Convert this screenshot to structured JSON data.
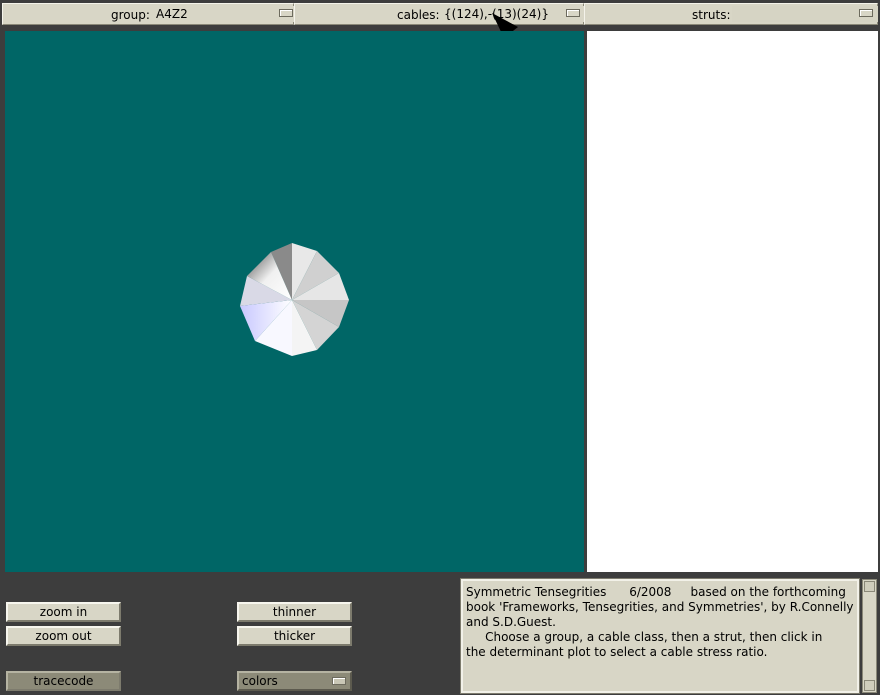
{
  "toolbar": {
    "group_label": "group:",
    "group_value": "A4Z2",
    "cables_label": "cables:",
    "cables_value": "{(124),-(13)(24)}",
    "struts_label": "struts:",
    "struts_value": ""
  },
  "buttons": {
    "zoom_in": "zoom in",
    "zoom_out": "zoom out",
    "thinner": "thinner",
    "thicker": "thicker",
    "tracecode": "tracecode"
  },
  "colors_dropdown": {
    "value": "colors"
  },
  "info_text": "Symmetric Tensegrities      6/2008     based on the forthcoming\nbook 'Frameworks, Tensegrities, and Symmetries', by R.Connelly\nand S.D.Guest.\n     Choose a group, a cable class, then a strut, then click in\nthe determinant plot to select a cable stress ratio.",
  "icons": {
    "arrow": "arrow-annotation-icon",
    "polyhedron": "octagon-solid-icon"
  },
  "palette": {
    "viewport_bg": "#006666",
    "panel_bg": "#d8d6c6",
    "background": "#3d3d3d"
  }
}
